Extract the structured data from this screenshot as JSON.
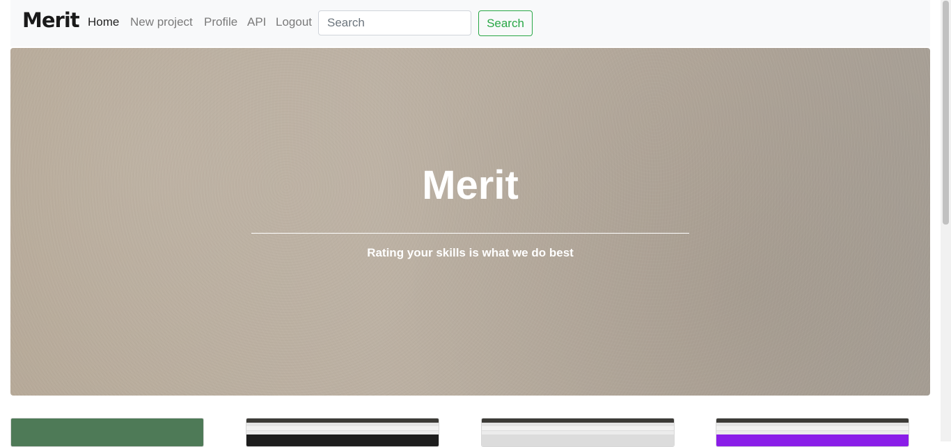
{
  "navbar": {
    "brand": "Merit",
    "links": [
      {
        "label": "Home",
        "active": true
      },
      {
        "label": "New project",
        "active": false
      },
      {
        "label": "Profile",
        "active": false
      },
      {
        "label": "API",
        "active": false
      },
      {
        "label": "Logout",
        "active": false
      }
    ],
    "search_placeholder": "Search",
    "search_value": "",
    "search_button": "Search"
  },
  "hero": {
    "title": "Merit",
    "subtitle": "Rating your skills is what we do best"
  },
  "projects": [
    {
      "thumbnail": "green-placeholder"
    },
    {
      "thumbnail": "browser-screenshot-dark"
    },
    {
      "thumbnail": "browser-screenshot-grey"
    },
    {
      "thumbnail": "browser-screenshot-purple"
    }
  ],
  "colors": {
    "accent_success": "#28a745",
    "navbar_bg": "#f8f9fa",
    "placeholder_green": "#4e7a57"
  }
}
